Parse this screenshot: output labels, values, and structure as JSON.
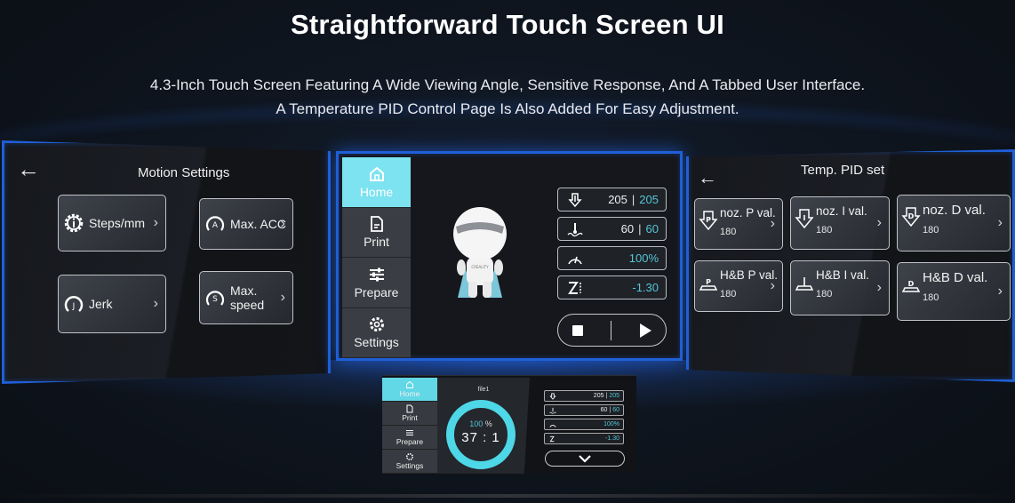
{
  "header": {
    "title": "Straightforward Touch Screen UI",
    "subtitle_line1": "4.3-Inch Touch Screen Featuring A Wide Viewing Angle, Sensitive Response, And A Tabbed User Interface.",
    "subtitle_line2": "A Temperature PID Control Page Is Also Added For Easy Adjustment."
  },
  "colors": {
    "accent_cyan": "#7de3f0",
    "value_teal": "#55c6d8",
    "frame_blue": "#1f5fd6"
  },
  "motion_settings": {
    "back_icon": "arrow-left-icon",
    "title": "Motion Settings",
    "items": [
      {
        "label": "Steps/mm",
        "icon": "gear-info-icon"
      },
      {
        "label": "Max. ACC",
        "icon": "acceleration-gauge-icon"
      },
      {
        "label": "Jerk",
        "icon": "jerk-gauge-icon"
      },
      {
        "label": "Max. speed",
        "icon": "speed-gauge-icon"
      }
    ],
    "chevron": "›"
  },
  "home_screen": {
    "nav": [
      {
        "label": "Home",
        "icon": "home-icon",
        "active": true
      },
      {
        "label": "Print",
        "icon": "document-icon",
        "active": false
      },
      {
        "label": "Prepare",
        "icon": "sliders-icon",
        "active": false
      },
      {
        "label": "Settings",
        "icon": "gear-icon",
        "active": false
      }
    ],
    "mascot_text": "CREALITY",
    "stats": [
      {
        "icon": "nozzle-temp-icon",
        "current": "205",
        "separator": "|",
        "target": "205"
      },
      {
        "icon": "bed-temp-icon",
        "current": "60",
        "separator": "|",
        "target": "60"
      },
      {
        "icon": "speed-icon",
        "current": "",
        "separator": "",
        "target": "100%"
      },
      {
        "icon": "z-offset-icon",
        "current": "",
        "separator": "",
        "target": "-1.30"
      }
    ],
    "controls": {
      "stop_icon": "stop-icon",
      "play_icon": "play-icon"
    }
  },
  "pid_settings": {
    "back_icon": "arrow-left-icon",
    "title": "Temp. PID set",
    "items": [
      {
        "label": "noz. P val.",
        "value": "180",
        "icon": "nozzle-p-icon"
      },
      {
        "label": "noz. I val.",
        "value": "180",
        "icon": "nozzle-i-icon"
      },
      {
        "label": "noz. D val.",
        "value": "180",
        "icon": "nozzle-d-icon"
      },
      {
        "label": "H&B P val.",
        "value": "180",
        "icon": "bed-p-icon"
      },
      {
        "label": "H&B I val.",
        "value": "180",
        "icon": "bed-i-icon"
      },
      {
        "label": "H&B D val.",
        "value": "180",
        "icon": "bed-d-icon"
      }
    ],
    "chevron": "›"
  },
  "print_screen": {
    "nav": [
      {
        "label": "Home",
        "active": true
      },
      {
        "label": "Print",
        "active": false
      },
      {
        "label": "Prepare",
        "active": false
      },
      {
        "label": "Settings",
        "active": false
      }
    ],
    "file_name": "file1",
    "progress_percent": 100,
    "progress_value": "100",
    "progress_unit": "%",
    "elapsed_time": "37 : 1",
    "stats": [
      {
        "current": "205",
        "separator": "|",
        "target": "205"
      },
      {
        "current": "60",
        "separator": "|",
        "target": "60"
      },
      {
        "current": "",
        "separator": "",
        "target": "100%"
      },
      {
        "current": "",
        "separator": "",
        "target": "-1.30"
      }
    ],
    "confirm_icon": "checkmark-icon"
  }
}
